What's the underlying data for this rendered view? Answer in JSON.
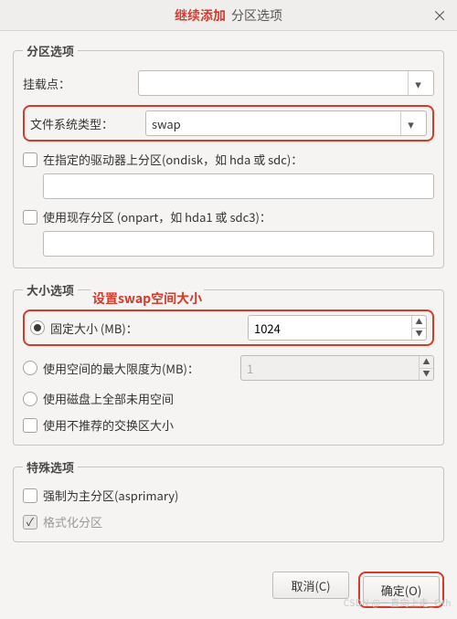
{
  "title": {
    "main": "继续添加",
    "sub": "分区选项",
    "close": "×"
  },
  "section_partition": {
    "legend": "分区选项",
    "mount": {
      "label": "挂载点：",
      "value": ""
    },
    "fstype": {
      "label": "文件系统类型：",
      "value": "swap"
    },
    "ondisk": {
      "label": "在指定的驱动器上分区(ondisk，如 hda 或 sdc)：",
      "value": ""
    },
    "onpart": {
      "label": "使用现存分区 (onpart，如 hda1 或 sdc3)：",
      "value": ""
    }
  },
  "section_size": {
    "legend": "大小选项",
    "annotation": "设置swap空间大小",
    "fixed": {
      "label": "固定大小 (MB)：",
      "value": "1024"
    },
    "maxsize": {
      "label": "使用空间的最大限度为(MB)：",
      "value": "1"
    },
    "fill": {
      "label": "使用磁盘上全部未用空间"
    },
    "recommended": {
      "label": "使用不推荐的交换区大小"
    }
  },
  "section_special": {
    "legend": "特殊选项",
    "asprimary": {
      "label": "强制为主分区(asprimary)"
    },
    "format": {
      "label": "格式化分区"
    }
  },
  "footer": {
    "cancel": "取消(C)",
    "ok": "确定(O)"
  },
  "watermark": "CSDN @一直向上走_Oth"
}
